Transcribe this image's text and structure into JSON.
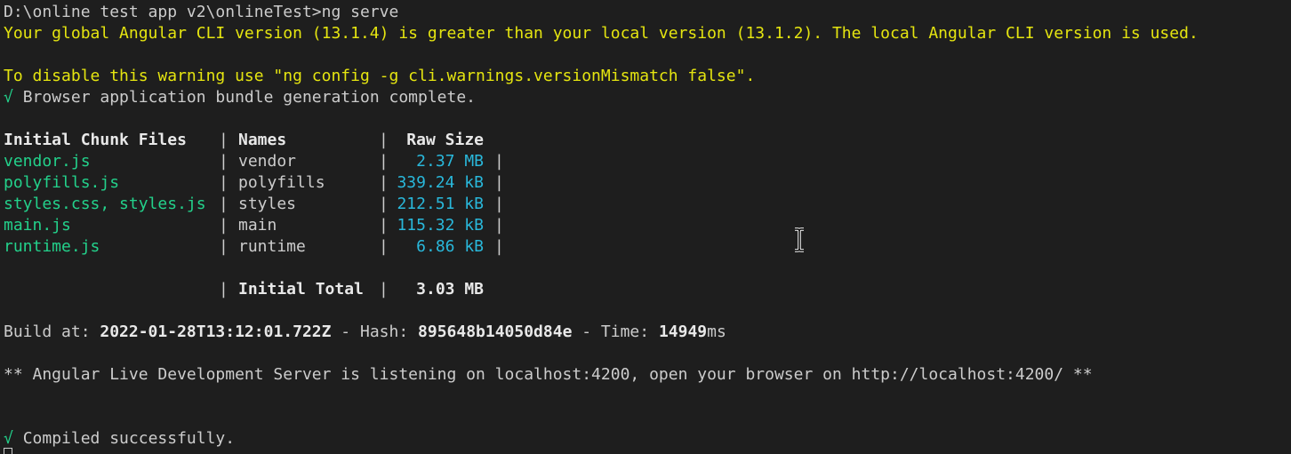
{
  "terminal": {
    "prompt": "D:\\online test app v2\\onlineTest>",
    "command": "ng serve",
    "warning_line1": "Your global Angular CLI version (13.1.4) is greater than your local version (13.1.2). The local Angular CLI version is used.",
    "warning_line2": "To disable this warning use \"ng config -g cli.warnings.versionMismatch false\".",
    "check_glyph": "√",
    "bundle_message": "Browser application bundle generation complete.",
    "table": {
      "headers": [
        "Initial Chunk Files",
        "Names",
        "Raw Size"
      ],
      "rows": [
        {
          "file": "vendor.js",
          "name": "vendor",
          "size": "2.37 MB"
        },
        {
          "file": "polyfills.js",
          "name": "polyfills",
          "size": "339.24 kB"
        },
        {
          "file": "styles.css, styles.js",
          "name": "styles",
          "size": "212.51 kB"
        },
        {
          "file": "main.js",
          "name": "main",
          "size": "115.32 kB"
        },
        {
          "file": "runtime.js",
          "name": "runtime",
          "size": "6.86 kB"
        }
      ],
      "total_label": "Initial Total",
      "total_size": "3.03 MB",
      "separator": "|"
    },
    "build": {
      "build_at_label": "Build at: ",
      "build_at_value": "2022-01-28T13:12:01.722Z",
      "hash_label": " - Hash: ",
      "hash_value": "895648b14050d84e",
      "time_label": " - Time: ",
      "time_value": "14949",
      "time_unit": "ms"
    },
    "server_message": "** Angular Live Development Server is listening on localhost:4200, open your browser on http://localhost:4200/ **",
    "compiled_message": "Compiled successfully."
  },
  "colors": {
    "background": "#1e1e1e",
    "text": "#cccccc",
    "warning": "#e5e510",
    "file": "#23d18b",
    "size": "#29b8db"
  },
  "icons": {
    "text_cursor": "ibeam-icon"
  }
}
